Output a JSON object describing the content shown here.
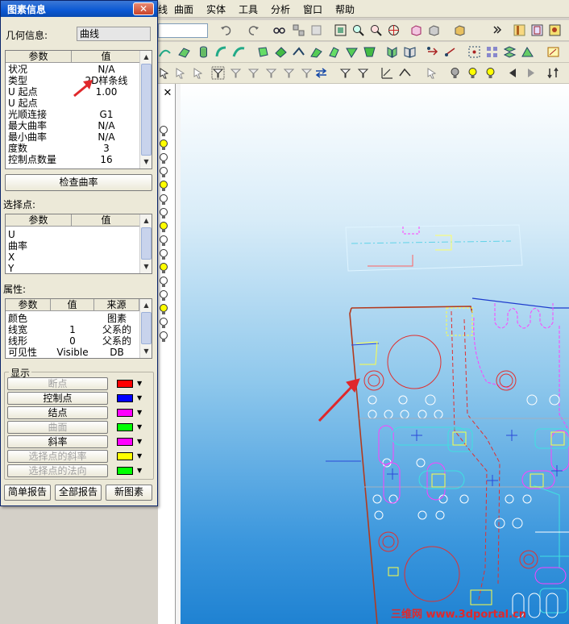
{
  "menubar": {
    "items": [
      "曲面",
      "实体",
      "工具",
      "分析",
      "窗口",
      "帮助"
    ],
    "partial_item": "线"
  },
  "dialog": {
    "title": "图素信息",
    "close_label": "✕",
    "geometry_label": "几何信息:",
    "geometry_value": "曲线",
    "param_table": {
      "headers": [
        "参数",
        "值"
      ],
      "rows": [
        {
          "param": "状况",
          "value": "N/A"
        },
        {
          "param": "类型",
          "value": "2D样条线"
        },
        {
          "param": "U 起点",
          "value": "1.00"
        },
        {
          "param": "U 起点",
          "value": ""
        },
        {
          "param": "光顺连接",
          "value": "G1"
        },
        {
          "param": "最大曲率",
          "value": "N/A"
        },
        {
          "param": "最小曲率",
          "value": "N/A"
        },
        {
          "param": "度数",
          "value": "3"
        },
        {
          "param": "控制点数量",
          "value": "16"
        }
      ]
    },
    "check_curvature_label": "检查曲率",
    "select_point_label": "选择点:",
    "point_table": {
      "headers": [
        "参数",
        "值"
      ],
      "rows": [
        {
          "param": "U",
          "value": ""
        },
        {
          "param": "曲率",
          "value": ""
        },
        {
          "param": "X",
          "value": ""
        },
        {
          "param": "Y",
          "value": ""
        }
      ]
    },
    "attributes_label": "属性:",
    "attr_table": {
      "headers": [
        "参数",
        "值",
        "来源"
      ],
      "rows": [
        {
          "param": "颜色",
          "value": "",
          "source": "图素"
        },
        {
          "param": "线宽",
          "value": "1",
          "source": "父系的"
        },
        {
          "param": "线形",
          "value": "0",
          "source": "父系的"
        },
        {
          "param": "可见性",
          "value": "Visible",
          "source": "DB"
        }
      ]
    },
    "display_label": "显示",
    "display_items": [
      {
        "label": "断点",
        "color": "#ff0000",
        "enabled": false
      },
      {
        "label": "控制点",
        "color": "#0000ff",
        "enabled": true
      },
      {
        "label": "结点",
        "color": "#ff00ff",
        "enabled": true
      },
      {
        "label": "曲面",
        "color": "#00ff00",
        "enabled": false
      },
      {
        "label": "斜率",
        "color": "#ff00ff",
        "enabled": true
      },
      {
        "label": "选择点的斜率",
        "color": "#ffff00",
        "enabled": false
      },
      {
        "label": "选择点的法向",
        "color": "#00ff00",
        "enabled": false
      }
    ],
    "footer_buttons": [
      "简单报告",
      "全部报告",
      "新图素"
    ]
  },
  "watermark": "三维网 www.3dportal.cn",
  "colors": {
    "accent_titlebar": "#0a58d4",
    "annotation_arrow": "#e0282b",
    "outline_curve": "#b23a1e"
  }
}
